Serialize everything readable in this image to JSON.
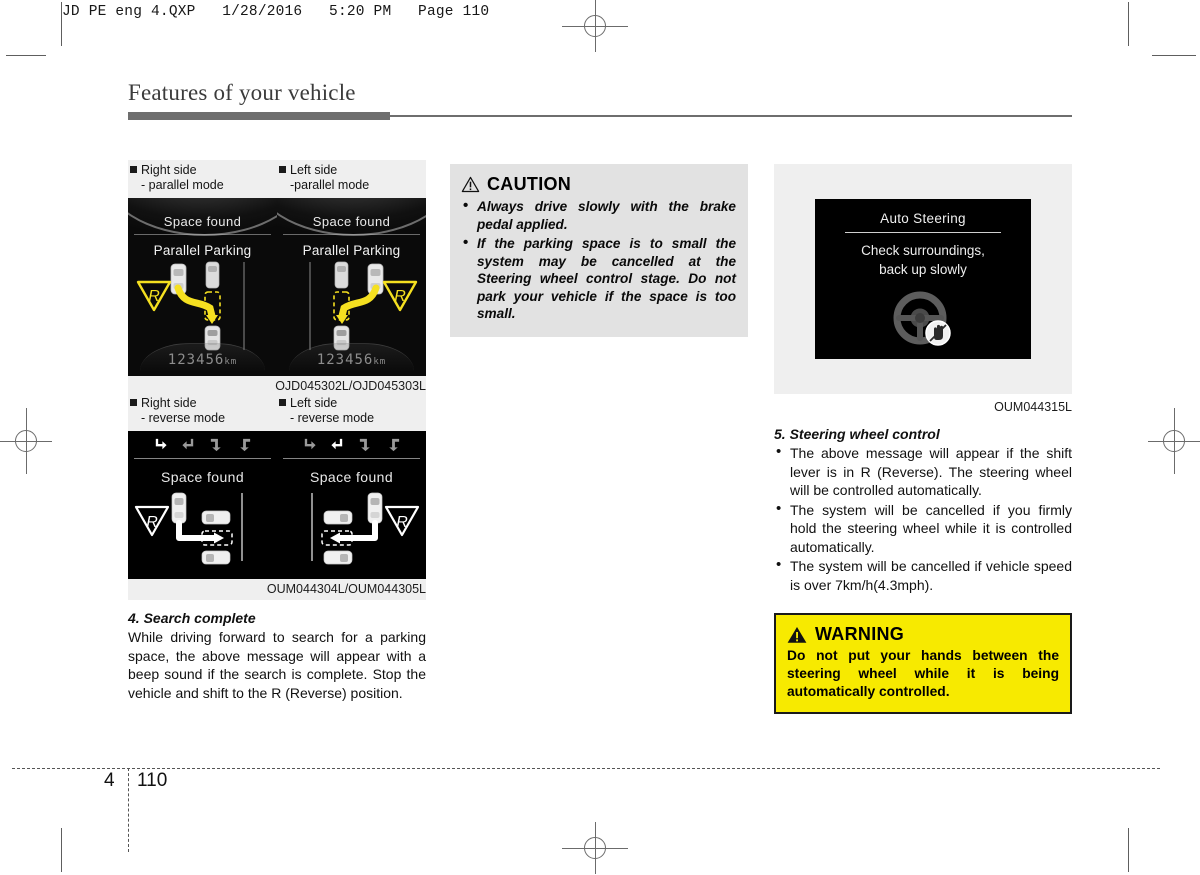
{
  "file_header": "JD PE eng 4.QXP   1/28/2016   5:20 PM   Page 110",
  "page_title": "Features of your vehicle",
  "footer": {
    "chapter": "4",
    "page": "110"
  },
  "left_column": {
    "parallel_labels": [
      {
        "row1": "Right side",
        "row2": "- parallel mode"
      },
      {
        "row1": "Left side",
        "row2": "-parallel mode"
      }
    ],
    "parallel_displays": [
      {
        "space": "Space found",
        "mode": "Parallel Parking",
        "gear": "R",
        "odometer": "123456",
        "unit": "km"
      },
      {
        "space": "Space found",
        "mode": "Parallel Parking",
        "gear": "R",
        "odometer": "123456",
        "unit": "km"
      }
    ],
    "parallel_caption": "OJD045302L/OJD045303L",
    "reverse_labels": [
      {
        "row1": "Right side",
        "row2": "- reverse mode"
      },
      {
        "row1": "Left side",
        "row2": "- reverse mode"
      }
    ],
    "reverse_displays": [
      {
        "space": "Space found",
        "gear": "R",
        "active_icon_index": 0
      },
      {
        "space": "Space found",
        "gear": "R",
        "active_icon_index": 1
      }
    ],
    "reverse_caption": "OUM044304L/OUM044305L",
    "section4": {
      "heading": "4. Search complete",
      "body": "While driving forward to search for a parking space, the above message will appear with a beep sound if the search is complete. Stop the vehicle and shift to the R (Reverse) position."
    }
  },
  "middle_column": {
    "caution": {
      "title": "CAUTION",
      "items": [
        "Always drive slowly with the brake pedal applied.",
        "If the parking space is to small the system may be cancelled at the Steering wheel control stage. Do not park your vehicle if the space is too small."
      ]
    }
  },
  "right_column": {
    "nav_display": {
      "title": "Auto Steering",
      "message_line1": "Check surroundings,",
      "message_line2": "back up slowly"
    },
    "nav_caption": "OUM044315L",
    "section5": {
      "heading": "5. Steering wheel control",
      "items": [
        "The above message will appear if the shift lever is in R (Reverse). The steering wheel will be controlled automatically.",
        "The system will be cancelled if you firmly hold the steering wheel while it is controlled automatically.",
        "The system will be cancelled if vehicle speed is over 7km/h(4.3mph)."
      ]
    },
    "warning": {
      "title": "WARNING",
      "text": "Do not put your hands between the steering wheel while it is being automatically controlled."
    }
  },
  "colors": {
    "warning_yellow": "#f7ea00",
    "caution_gray": "#e2e2e2",
    "rule_gray": "#6e6e6e",
    "display_yellow": "#f5e020"
  }
}
